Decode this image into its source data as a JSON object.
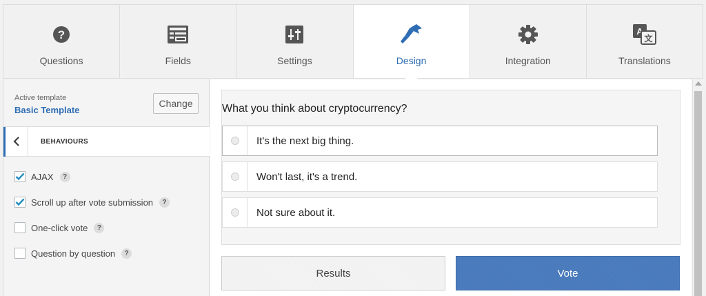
{
  "tabs": [
    {
      "label": "Questions",
      "icon": "question-circle-icon",
      "active": false
    },
    {
      "label": "Fields",
      "icon": "form-fields-icon",
      "active": false
    },
    {
      "label": "Settings",
      "icon": "sliders-icon",
      "active": false
    },
    {
      "label": "Design",
      "icon": "paint-brush-icon",
      "active": true
    },
    {
      "label": "Integration",
      "icon": "gear-icon",
      "active": false
    },
    {
      "label": "Translations",
      "icon": "translate-icon",
      "active": false
    }
  ],
  "template": {
    "caption": "Active template",
    "name": "Basic Template",
    "change_label": "Change"
  },
  "behaviours": {
    "title": "BEHAVIOURS",
    "options": [
      {
        "label": "AJAX",
        "checked": true,
        "help": "?"
      },
      {
        "label": "Scroll up after vote submission",
        "checked": true,
        "help": "?"
      },
      {
        "label": "One-click vote",
        "checked": false,
        "help": "?"
      },
      {
        "label": "Question by question",
        "checked": false,
        "help": "?"
      }
    ]
  },
  "poll": {
    "question": "What you think about cryptocurrency?",
    "choices": [
      "It's the next big thing.",
      "Won't last, it's a trend.",
      "Not sure about it."
    ],
    "results_label": "Results",
    "vote_label": "Vote"
  },
  "colors": {
    "accent": "#2e6db4",
    "vote_button": "#4a7aba"
  }
}
